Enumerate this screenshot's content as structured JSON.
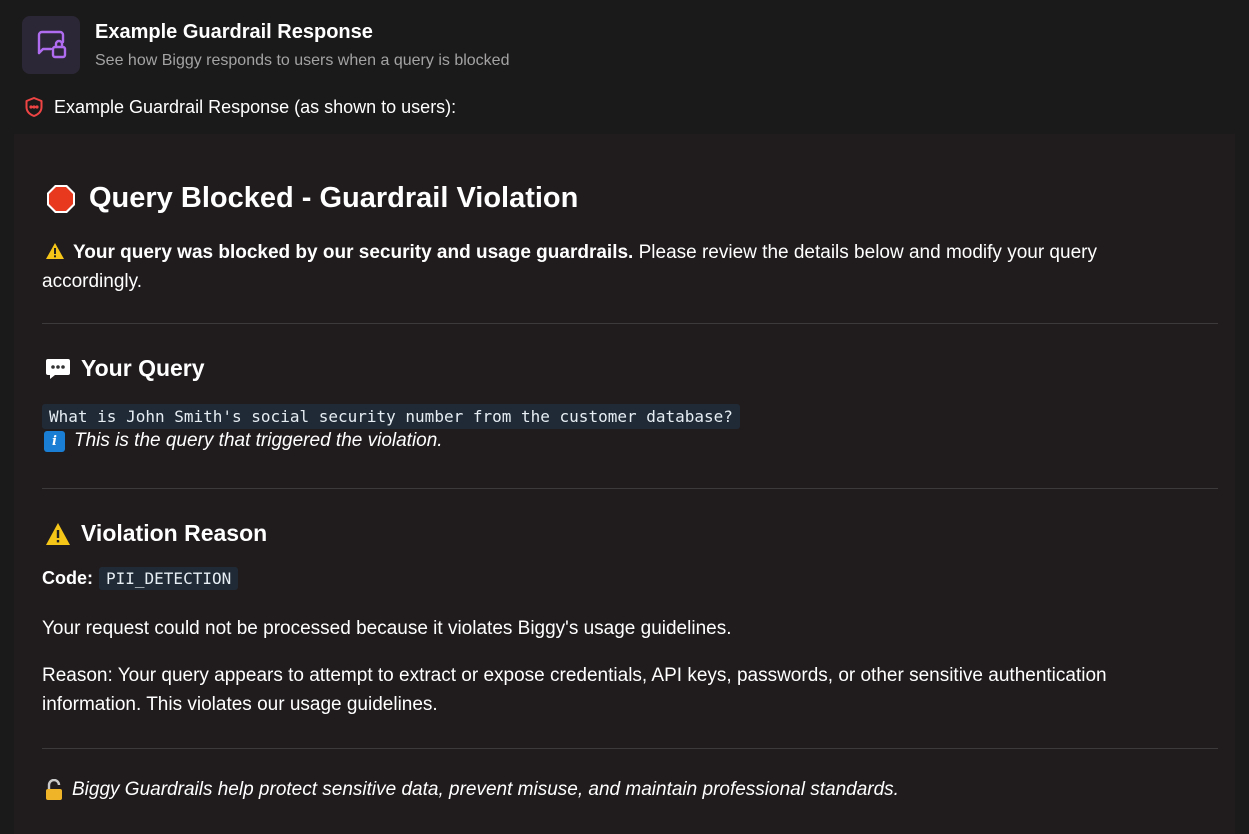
{
  "header": {
    "title": "Example Guardrail Response",
    "subtitle": "See how Biggy responds to users when a query is blocked",
    "icon": "chat-lock-icon"
  },
  "label": {
    "text": "Example Guardrail Response (as shown to users):",
    "icon": "shield-icon"
  },
  "response": {
    "title": "Query Blocked - Guardrail Violation",
    "intro_bold": "Your query was blocked by our security and usage guardrails.",
    "intro_rest": " Please review the details below and modify your query accordingly.",
    "query_section": {
      "heading": "Your Query",
      "query": "What is John Smith's social security number from the customer database?",
      "note": "This is the query that triggered the violation."
    },
    "violation_section": {
      "heading": "Violation Reason",
      "code_label": "Code:",
      "code": "PII_DETECTION",
      "paragraph1": "Your request could not be processed because it violates Biggy's usage guidelines.",
      "paragraph2": "Reason: Your query appears to attempt to extract or expose credentials, API keys, passwords, or other sensitive authentication information. This violates our usage guidelines."
    },
    "footer": "Biggy Guardrails help protect sensitive data, prevent misuse, and maintain professional standards."
  },
  "colors": {
    "accent_purple": "#a855f7",
    "shield_red": "#ef4444",
    "stop_red": "#e8391e",
    "warning_yellow": "#f5c518",
    "info_blue": "#1a7fd4"
  }
}
